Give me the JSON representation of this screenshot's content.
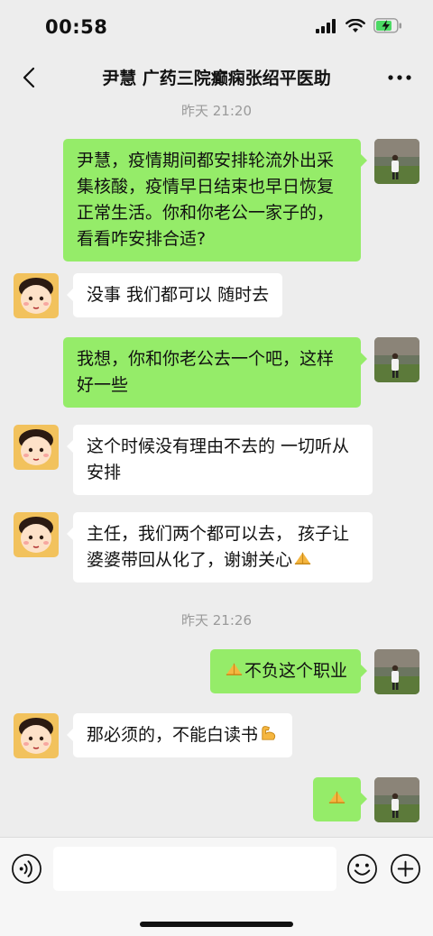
{
  "status_bar": {
    "time": "00:58",
    "icons": [
      "signal-icon",
      "wifi-icon",
      "battery-charging-icon"
    ],
    "battery_color": "#4cd964"
  },
  "nav": {
    "title": "尹慧  广药三院癫痫张绍平医助",
    "back_icon": "chevron-left-icon",
    "more_icon": "more-icon"
  },
  "messages": {
    "ts1": "昨天 21:20",
    "m1": "尹慧，疫情期间都安排轮流外出采集核酸，疫情早日结束也早日恢复正常生活。你和你老公一家子的，看看咋安排合适?",
    "m2": "没事 我们都可以 随时去",
    "m3": "我想，你和你老公去一个吧，这样好一些",
    "m4": "这个时候没有理由不去的 一切听从安排",
    "m5": "主任，我们两个都可以去， 孩子让婆婆带回从化了，谢谢关心",
    "ts2": "昨天 21:26",
    "m6": "不负这个职业",
    "m7": "那必须的，不能白读书"
  },
  "input_bar": {
    "value": "",
    "icons": [
      "voice-icon",
      "emoji-icon",
      "plus-icon"
    ]
  },
  "colors": {
    "background": "#ededed",
    "sent_bubble": "#95ec69",
    "received_bubble": "#ffffff",
    "timestamp": "#9a9a9a"
  }
}
